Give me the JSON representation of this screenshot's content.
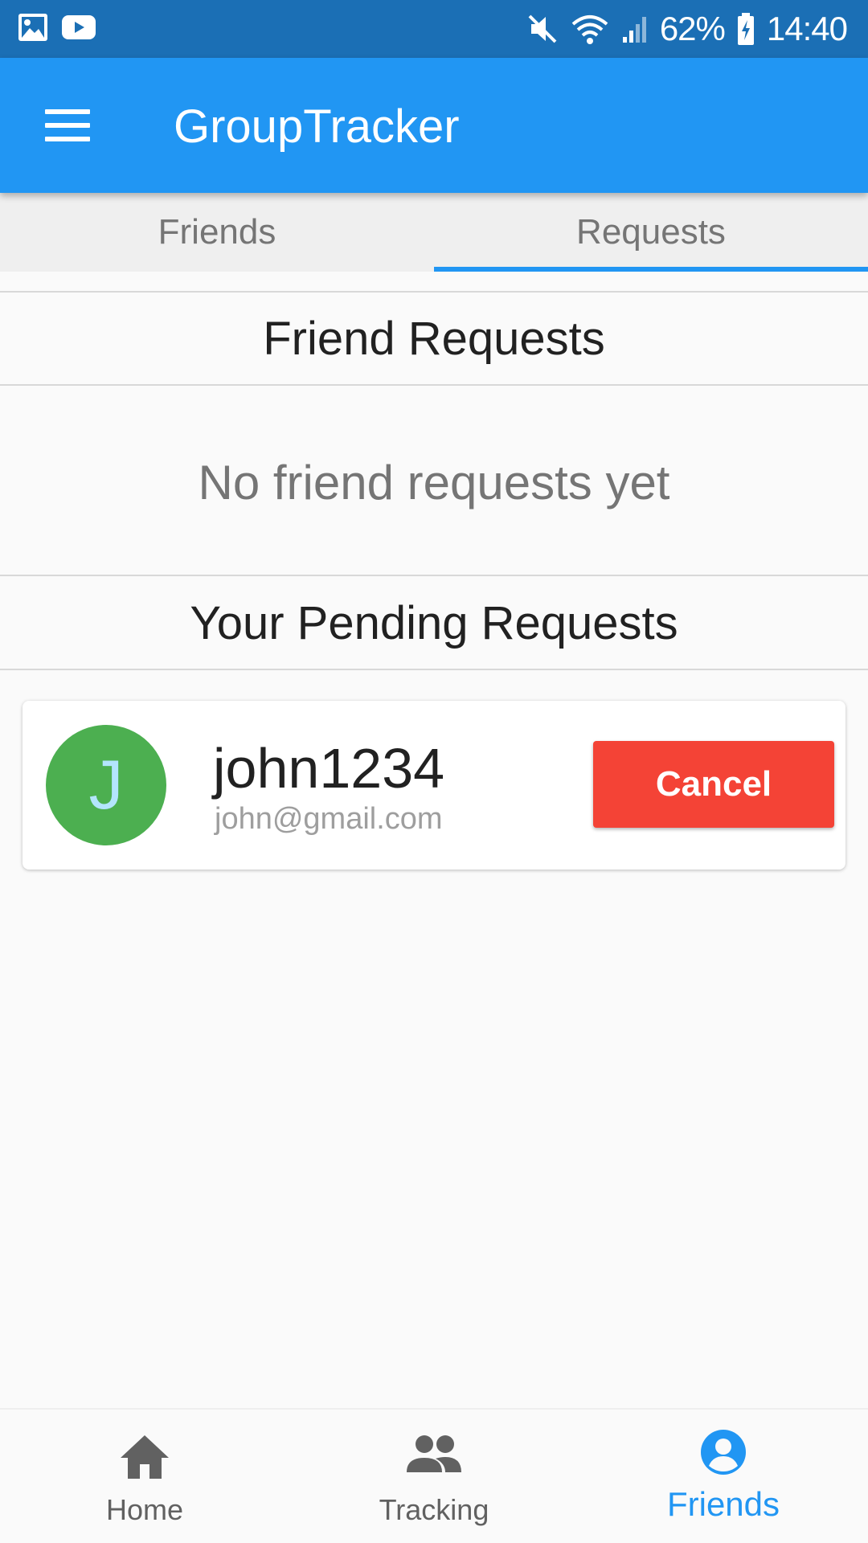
{
  "status_bar": {
    "battery": "62%",
    "time": "14:40",
    "icons": [
      "gallery-icon",
      "youtube-icon",
      "mute-icon",
      "wifi-icon",
      "signal-icon",
      "battery-charging-icon"
    ]
  },
  "app_bar": {
    "title": "GroupTracker",
    "menu_icon": "menu-icon"
  },
  "tabs": [
    {
      "label": "Friends",
      "active": false
    },
    {
      "label": "Requests",
      "active": true
    }
  ],
  "sections": {
    "friend_requests": {
      "title": "Friend Requests",
      "empty_text": "No friend requests yet"
    },
    "pending_requests": {
      "title": "Your Pending Requests",
      "items": [
        {
          "avatar_initial": "J",
          "username": "john1234",
          "email": "john@gmail.com",
          "action_label": "Cancel"
        }
      ]
    }
  },
  "bottom_nav": [
    {
      "label": "Home",
      "icon": "home-icon",
      "active": false
    },
    {
      "label": "Tracking",
      "icon": "group-icon",
      "active": false
    },
    {
      "label": "Friends",
      "icon": "account-circle-icon",
      "active": true
    }
  ],
  "colors": {
    "primary": "#2196f3",
    "status_bar": "#1b6fb5",
    "cancel": "#f44336",
    "avatar": "#4caf50"
  }
}
